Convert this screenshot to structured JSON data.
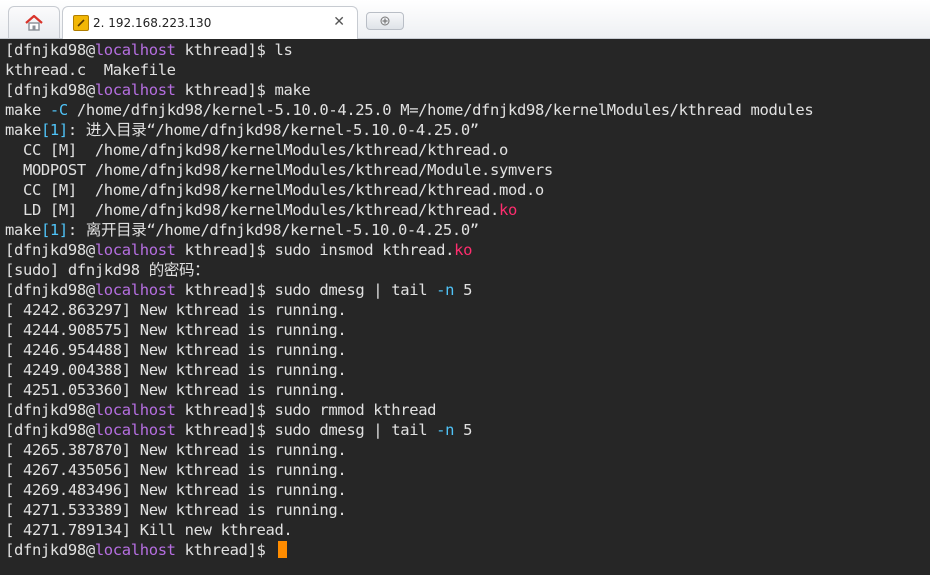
{
  "tabbar": {
    "home_icon": "home-icon",
    "session_tab": {
      "title": "2. 192.168.223.130",
      "icon": "terminal-session-icon",
      "close": "✕"
    },
    "new_tab_icon": "new-tab-icon"
  },
  "terminal": {
    "prompt": {
      "open": "[",
      "user": "dfnjkd98",
      "at": "@",
      "host": "localhost",
      "path": " kthread]$ "
    },
    "lines": {
      "l1_cmd": "ls",
      "l2": "kthread.c  Makefile",
      "l3_cmd": "make",
      "l4_a": "make ",
      "l4_opt": "-C",
      "l4_b": " /home/dfnjkd98/kernel-5.10.0-4.25.0 M=/home/dfnjkd98/kernelModules/kthread modules",
      "l5_a": "make",
      "l5_num": "[1]",
      "l5_b": ": 进入目录“/home/dfnjkd98/kernel-5.10.0-4.25.0”",
      "l6": "  CC [M]  /home/dfnjkd98/kernelModules/kthread/kthread.o",
      "l7": "  MODPOST /home/dfnjkd98/kernelModules/kthread/Module.symvers",
      "l8": "  CC [M]  /home/dfnjkd98/kernelModules/kthread/kthread.mod.o",
      "l9_a": "  LD [M]  /home/dfnjkd98/kernelModules/kthread/kthread.",
      "l9_ko": "ko",
      "l10_a": "make",
      "l10_num": "[1]",
      "l10_b": ": 离开目录“/home/dfnjkd98/kernel-5.10.0-4.25.0”",
      "l11_cmd": "sudo insmod kthread.",
      "l11_ko": "ko",
      "l12": "[sudo] dfnjkd98 的密码：",
      "l13_cmd": "sudo dmesg | tail ",
      "l13_opt": "-n",
      "l13_end": " 5",
      "l14": "[ 4242.863297] New kthread is running.",
      "l15": "[ 4244.908575] New kthread is running.",
      "l16": "[ 4246.954488] New kthread is running.",
      "l17": "[ 4249.004388] New kthread is running.",
      "l18": "[ 4251.053360] New kthread is running.",
      "l19_cmd": "sudo rmmod kthread",
      "l20_cmd": "sudo dmesg | tail ",
      "l20_opt": "-n",
      "l20_end": " 5",
      "l21": "[ 4265.387870] New kthread is running.",
      "l22": "[ 4267.435056] New kthread is running.",
      "l23": "[ 4269.483496] New kthread is running.",
      "l24": "[ 4271.533389] New kthread is running.",
      "l25": "[ 4271.789134] Kill new kthread."
    },
    "colors": {
      "background": "#262626",
      "text": "#e0e0e0",
      "host": "#b56ee0",
      "option": "#4fc3f7",
      "ko": "#ff2d6e",
      "cursor": "#ff8c00"
    }
  }
}
